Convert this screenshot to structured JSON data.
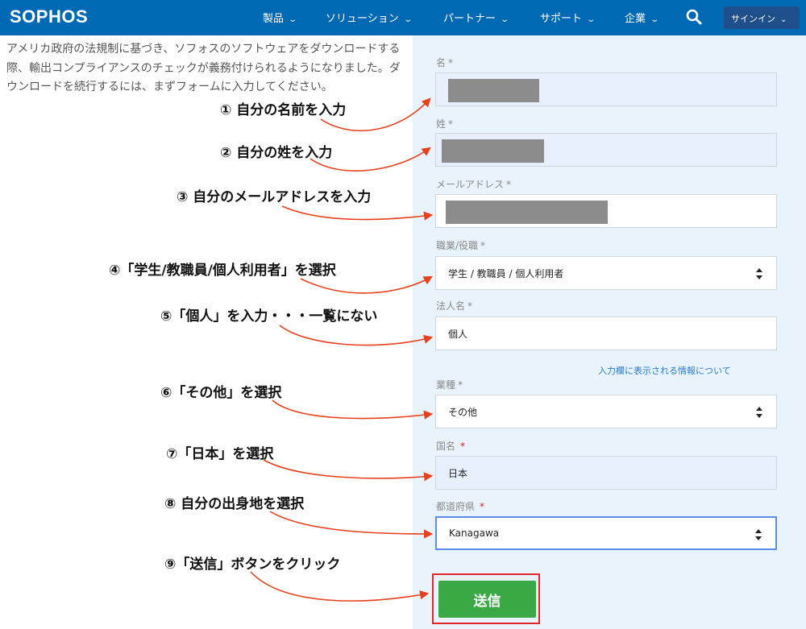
{
  "nav": {
    "logo": "SOPHOS",
    "items": [
      "製品",
      "ソリューション",
      "パートナー",
      "サポート",
      "企業"
    ],
    "signin_label": "サインイン"
  },
  "intro_text": "アメリカ政府の法規制に基づき、ソフォスのソフトウェアをダウンロードする際、輸出コンプライアンスのチェックが義務付けられるようになりました。ダウンロードを続行するには、まずフォームに入力してください。",
  "form": {
    "first_name": {
      "label": "名",
      "required_mark": "*",
      "value": ""
    },
    "last_name": {
      "label": "姓",
      "required_mark": "*",
      "value": ""
    },
    "email": {
      "label": "メールアドレス",
      "required_mark": "*",
      "value": ""
    },
    "job_role": {
      "label": "職業/役職",
      "required_mark": "*",
      "value": "学生 / 教職員 / 個人利用者"
    },
    "company": {
      "label": "法人名",
      "required_mark": "*",
      "value": "個人"
    },
    "info_link": "入力欄に表示される情報について",
    "industry": {
      "label": "業種",
      "required_mark": "*",
      "value": "その他"
    },
    "country": {
      "label": "国名",
      "required_mark": "*",
      "value": "日本"
    },
    "prefecture": {
      "label": "都道府県",
      "required_mark": "*",
      "value": "Kanagawa"
    },
    "submit_label": "送信"
  },
  "annotations": [
    "① 自分の名前を入力",
    "② 自分の姓を入力",
    "③ 自分のメールアドレスを入力",
    "④「学生/教職員/個人利用者」を選択",
    "⑤「個人」を入力・・・一覧にない",
    "⑥「その他」を選択",
    "⑦「日本」を選択",
    "⑧ 自分の出身地を選択",
    "⑨「送信」ボタンをクリック"
  ],
  "colors": {
    "nav_bg": "#0069b4",
    "panel_bg": "#e8f3fb",
    "submit_bg": "#3aa845",
    "arrow": "#e8401c",
    "highlight_box": "#e3262a",
    "required_red": "#e02020"
  }
}
